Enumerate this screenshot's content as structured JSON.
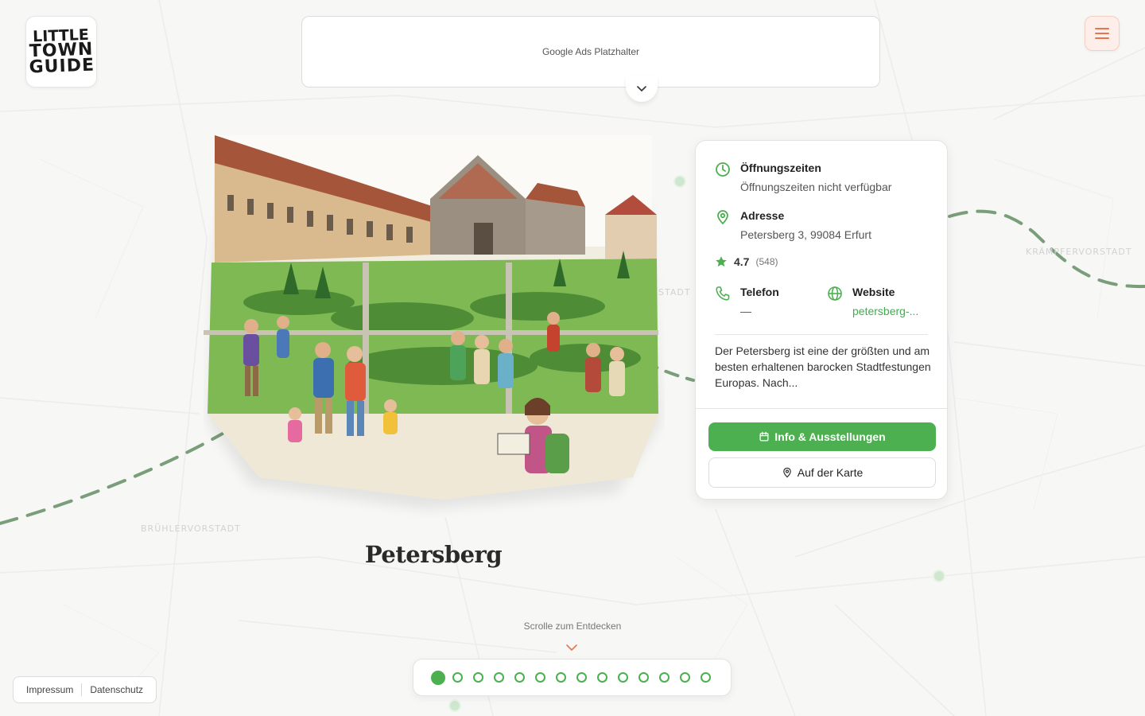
{
  "logo": {
    "line1": "LITTLE",
    "line2": "TOWN",
    "line3": "GUIDE"
  },
  "ad": {
    "text": "Google Ads Platzhalter"
  },
  "map": {
    "labels": [
      "KRÄMPFERVORSTADT",
      "BRÜHLERVORSTADT",
      "STADT"
    ]
  },
  "place": {
    "title": "Petersberg"
  },
  "info": {
    "hours_label": "Öffnungszeiten",
    "hours_value": "Öffnungszeiten nicht verfügbar",
    "address_label": "Adresse",
    "address_value": "Petersberg 3, 99084 Erfurt",
    "rating": "4.7",
    "rating_count": "(548)",
    "phone_label": "Telefon",
    "phone_value": "—",
    "website_label": "Website",
    "website_value": "petersberg-...",
    "description": "Der Petersberg ist eine der größten und am besten erhaltenen barocken Stadtfestungen Europas. Nach...",
    "primary_button": "Info & Ausstellungen",
    "secondary_button": "Auf der Karte"
  },
  "scroll_hint": "Scrolle zum Entdecken",
  "pagination": {
    "total": 14,
    "active": 0
  },
  "footer": {
    "impressum": "Impressum",
    "datenschutz": "Datenschutz"
  },
  "colors": {
    "accent": "#4caf50",
    "menu_accent": "#e8744f",
    "route": "#7a9e7a"
  }
}
